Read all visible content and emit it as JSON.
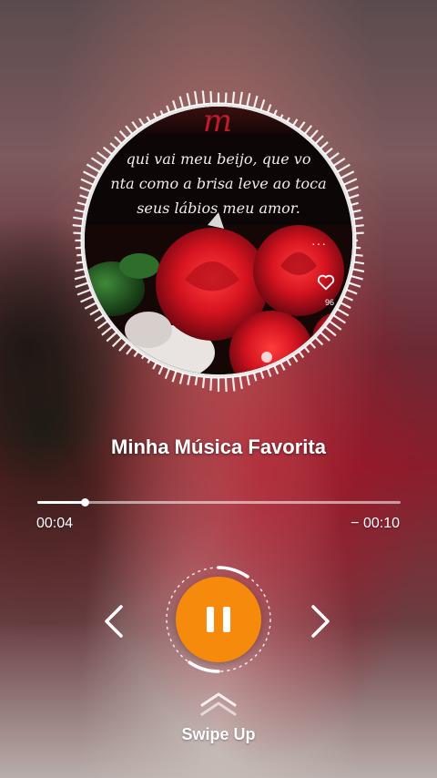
{
  "album": {
    "cover_title": "m",
    "cover_lines": [
      "qui vai meu beijo, que vo",
      "nta como a brisa  leve ao toca",
      "seus lábios  meu amor."
    ],
    "more_icon": "more-dots-icon",
    "heart_icon": "heart-outline-icon",
    "like_count": "96"
  },
  "song": {
    "title": "Minha Música Favorita"
  },
  "progress": {
    "elapsed": "00:04",
    "remaining": "− 00:10",
    "fraction": 0.13
  },
  "controls": {
    "prev_icon": "chevron-left-icon",
    "play_pause_icon": "pause-icon",
    "next_icon": "chevron-right-icon",
    "accent_color": "#f58a0c"
  },
  "swipe": {
    "icon": "double-chevron-up-icon",
    "label": "Swipe Up"
  }
}
